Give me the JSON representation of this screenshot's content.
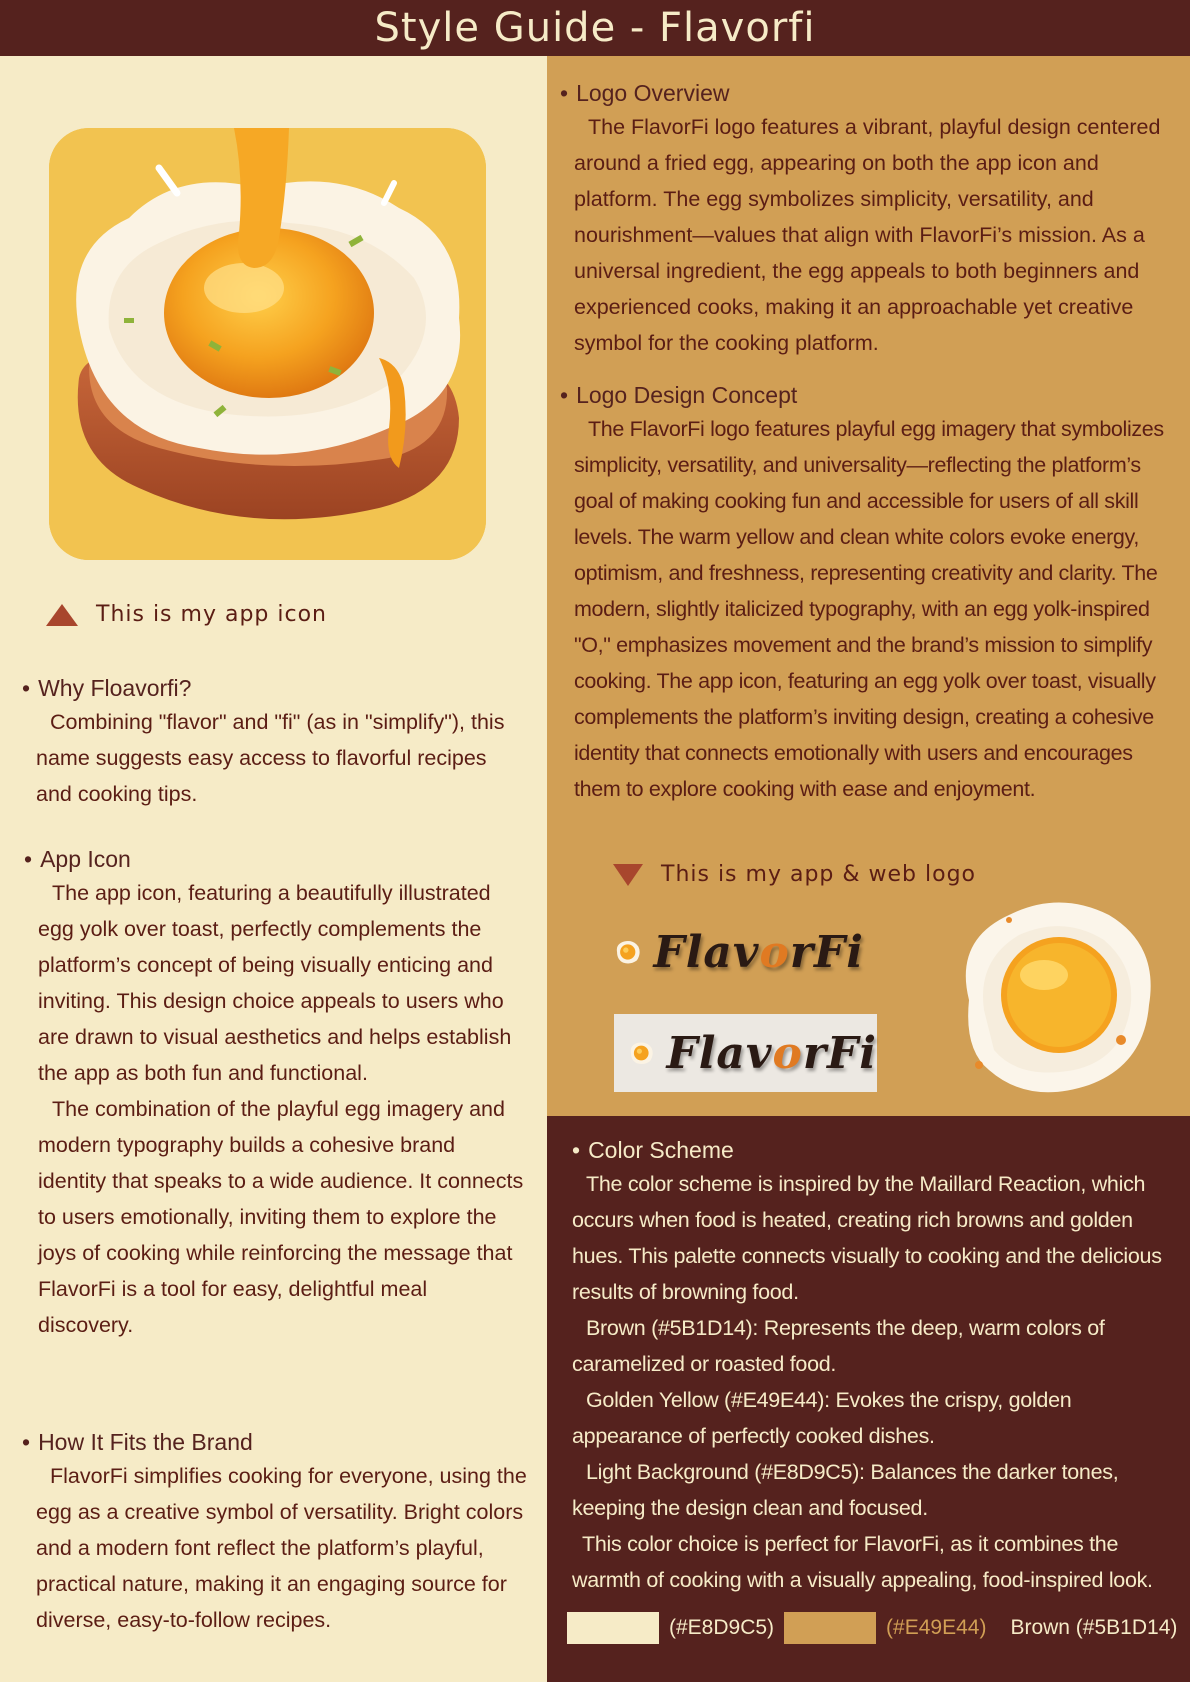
{
  "header": {
    "title": "Style Guide - Flavorfi"
  },
  "left": {
    "icon_caption": "This is my app icon",
    "sections": [
      {
        "title": "Why Floavorfi?",
        "paragraphs": [
          "Combining \"flavor\" and \"fi\" (as in \"simplify\"), this name suggests easy access to flavorful recipes and cooking tips."
        ]
      },
      {
        "title": "App Icon",
        "paragraphs": [
          "The app icon, featuring a beautifully illustrated egg yolk over toast, perfectly complements the platform’s concept of being visually enticing and inviting. This design choice appeals to users who are drawn to visual aesthetics and helps establish the app as both fun and functional.",
          "The combination of the playful egg imagery and modern typography builds a cohesive brand identity that speaks to a wide audience. It connects to users emotionally, inviting them to explore the joys of cooking while reinforcing the message that FlavorFi is a tool for easy, delightful meal discovery."
        ]
      },
      {
        "title": "How It Fits the Brand",
        "paragraphs": [
          "FlavorFi simplifies cooking for everyone, using the egg as a creative symbol of versatility. Bright colors and a modern font reflect the platform’s playful, practical nature, making it an engaging source for diverse, easy-to-follow recipes."
        ]
      }
    ]
  },
  "right": {
    "sections": [
      {
        "title": "Logo Overview",
        "paragraphs": [
          "The FlavorFi logo features a vibrant, playful design centered around a fried egg, appearing on both the app icon and platform. The egg symbolizes simplicity, versatility, and nourishment—values that align with FlavorFi’s mission. As a universal ingredient, the egg appeals to both beginners and experienced cooks, making it an approachable yet creative symbol for the cooking platform."
        ]
      },
      {
        "title": "Logo Design Concept",
        "paragraphs": [
          "The FlavorFi logo features playful egg imagery that symbolizes simplicity, versatility, and universality—reflecting the platform’s goal of making cooking fun and accessible for users of all skill levels. The warm yellow and clean white colors evoke energy, optimism, and freshness, representing creativity and clarity. The modern, slightly italicized typography, with an egg yolk-inspired \"O,\" emphasizes movement and the brand’s mission to simplify cooking. The app icon, featuring an egg yolk over toast, visually complements the platform’s inviting design, creating a cohesive identity that connects emotionally with users and encourages them to explore cooking with ease and enjoyment."
        ]
      }
    ],
    "logo_caption": "This is my app & web logo",
    "logo_word": {
      "before": "Flav",
      "o": "o",
      "after": "rFi"
    },
    "color_section": {
      "title": "Color Scheme",
      "paragraphs": [
        "The color scheme is inspired by the Maillard Reaction, which occurs when food is heated, creating rich browns and golden hues. This palette connects visually to cooking and the delicious results of browning food.",
        "Brown (#5B1D14): Represents the deep, warm colors of caramelized or roasted food.",
        "Golden Yellow (#E49E44): Evokes the crispy, golden appearance of perfectly cooked dishes.",
        "Light Background (#E8D9C5): Balances the darker tones, keeping the design clean and focused.",
        "This color choice is perfect for FlavorFi, as it combines the warmth of cooking with a visually appealing, food-inspired look."
      ]
    },
    "swatches": [
      {
        "label": "(#E8D9C5)",
        "color": "#f6ebc7",
        "text_color": "#f6ebc7"
      },
      {
        "label": "(#E49E44)",
        "color": "#d19f55",
        "text_color": "#d19f55"
      },
      {
        "label": "Brown (#5B1D14)",
        "color": "#55221e",
        "text_color": "#f6ebc7"
      }
    ]
  },
  "colors": {
    "brown": "#5B1D14",
    "golden": "#E49E44",
    "light": "#E8D9C5"
  }
}
